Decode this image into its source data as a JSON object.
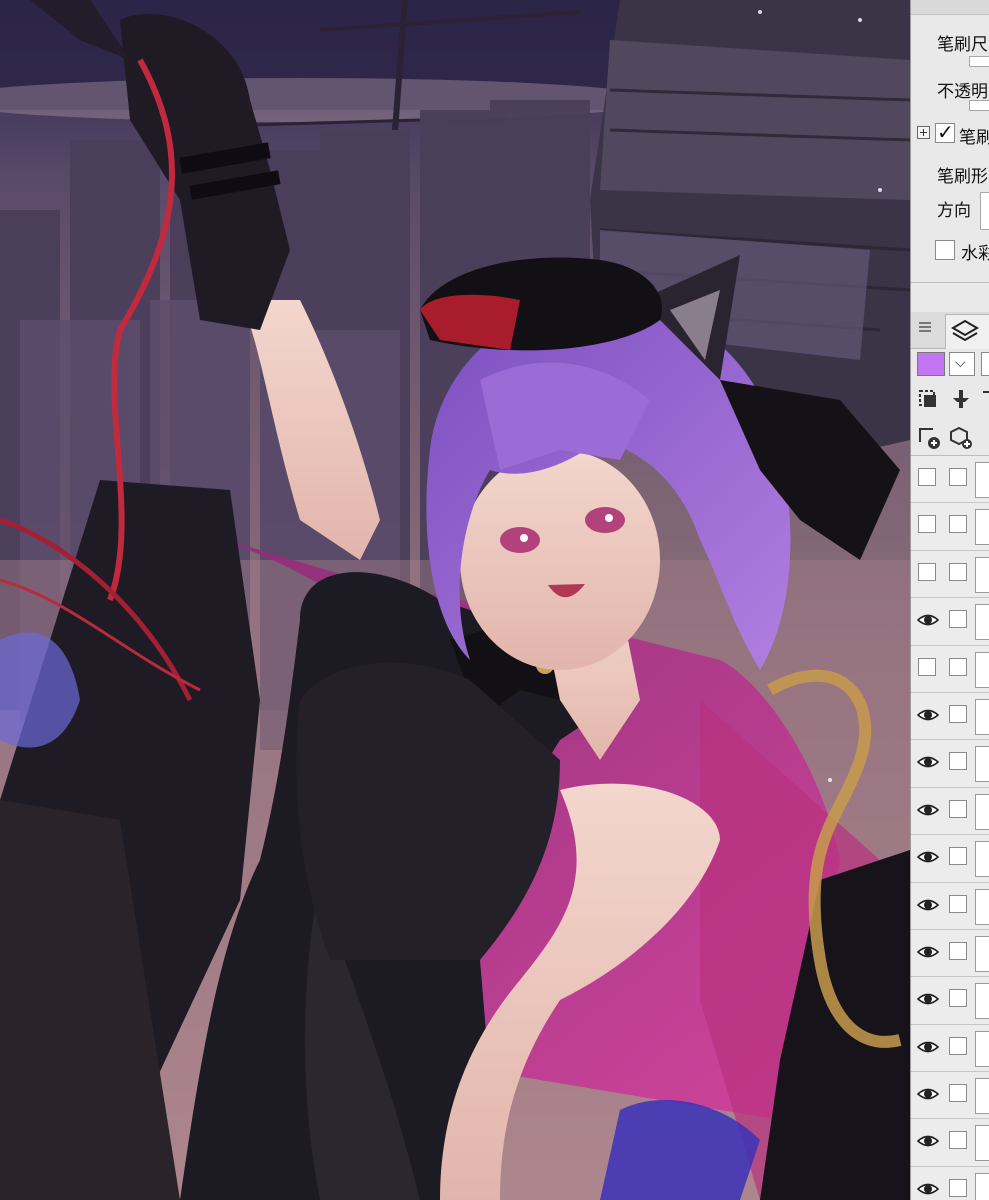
{
  "panel": {
    "brush_props": {
      "brush_size_label": "笔刷尺",
      "opacity_label": "不透明",
      "brush_label": "笔刷",
      "brush_checked": true,
      "brush_shape_label": "笔刷形",
      "direction_label": "方向",
      "watercolor_label": "水彩",
      "watercolor_checked": false
    },
    "layers": {
      "current_color": "#c376f2",
      "dropdown_glyph": "⌵",
      "rows": [
        {
          "visible": false
        },
        {
          "visible": false
        },
        {
          "visible": false
        },
        {
          "visible": true
        },
        {
          "visible": false
        },
        {
          "visible": true
        },
        {
          "visible": true
        },
        {
          "visible": true
        },
        {
          "visible": true
        },
        {
          "visible": true
        },
        {
          "visible": true
        },
        {
          "visible": true
        },
        {
          "visible": true
        },
        {
          "visible": true
        },
        {
          "visible": true
        },
        {
          "visible": true
        }
      ]
    }
  },
  "canvas": {
    "artwork": "purple-haired catgirl illustration",
    "palette": {
      "sky": "#2b2346",
      "city": "#6c5466",
      "hair": "#8a5fc9",
      "skin": "#f0cdc4",
      "dress": "#1c1a22",
      "accent": "#c2378e"
    }
  }
}
